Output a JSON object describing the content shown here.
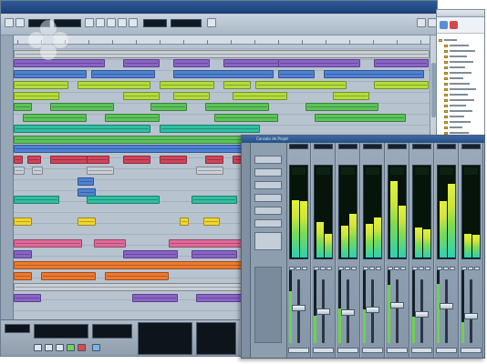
{
  "mixer": {
    "title": "Console de Projet",
    "channels": [
      {
        "label": "",
        "level_left": 0.72,
        "level_right": 0.7,
        "fader": 0.55
      },
      {
        "label": "",
        "level_left": 0.44,
        "level_right": 0.3,
        "fader": 0.5
      },
      {
        "label": "",
        "level_left": 0.4,
        "level_right": 0.55,
        "fader": 0.48
      },
      {
        "label": "",
        "level_left": 0.42,
        "level_right": 0.5,
        "fader": 0.52
      },
      {
        "label": "",
        "level_left": 0.95,
        "level_right": 0.65,
        "fader": 0.6
      },
      {
        "label": "",
        "level_left": 0.38,
        "level_right": 0.35,
        "fader": 0.45
      },
      {
        "label": "",
        "level_left": 0.7,
        "level_right": 0.92,
        "fader": 0.58
      },
      {
        "label": "",
        "level_left": 0.3,
        "level_right": 0.28,
        "fader": 0.42
      }
    ]
  },
  "colors": {
    "purple": "#8a63c9",
    "blue": "#4e82d4",
    "lime": "#b4dc3c",
    "green": "#5cc45a",
    "teal": "#2fbfa2",
    "red": "#d2445a",
    "pink": "#e06a9a",
    "orange": "#ee7a2e",
    "yellow": "#f2d530",
    "grey": "#c9cfd6"
  },
  "icons": {
    "watermark": "flower-watermark-icon",
    "folder": "folder-icon"
  }
}
